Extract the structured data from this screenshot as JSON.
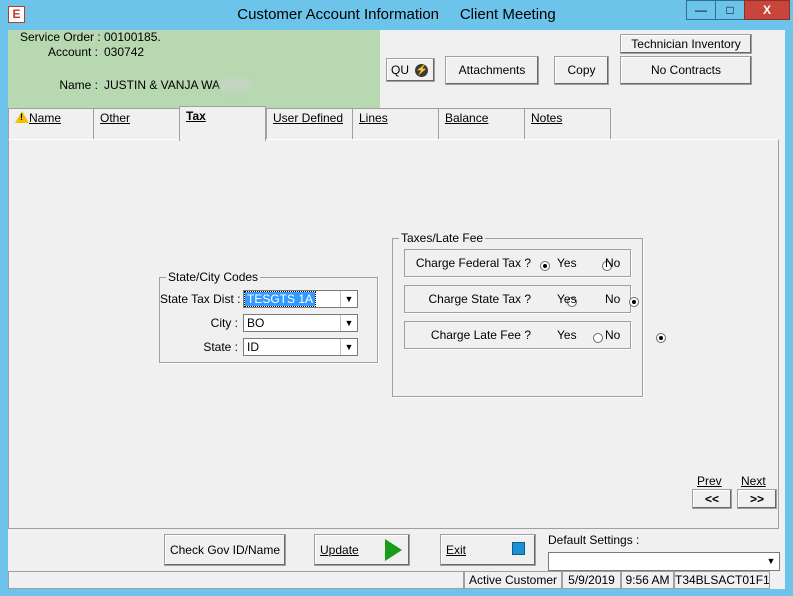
{
  "window": {
    "app_icon_letter": "E",
    "title": "Customer Account Information     Client Meeting",
    "min_label": "—",
    "max_label": "□",
    "close_label": "X"
  },
  "info": {
    "service_order_label": "Service Order :",
    "service_order_value": "00100185.",
    "account_label": "Account :",
    "account_value": "030742",
    "name_label": "Name :",
    "name_value": "JUSTIN & VANJA WA"
  },
  "toolbar": {
    "qu_label": "QU",
    "attachments_label": "Attachments",
    "copy_label": "Copy",
    "technician_inventory_label": "Technician Inventory",
    "no_contracts_label": "No Contracts"
  },
  "tabs": [
    {
      "label": "Name",
      "warning_icon": "warning-icon"
    },
    {
      "label": "Other"
    },
    {
      "label": "Tax"
    },
    {
      "label": "User Defined"
    },
    {
      "label": "Lines"
    },
    {
      "label": "Balance"
    },
    {
      "label": "Notes"
    }
  ],
  "state_city": {
    "group_title": "State/City Codes",
    "state_tax_dist_label": "State Tax Dist :",
    "state_tax_dist_value": "TESGTS 1A",
    "city_label": "City :",
    "city_value": "BO",
    "state_label": "State :",
    "state_value": "ID"
  },
  "taxes": {
    "group_title": "Taxes/Late Fee",
    "rows": [
      {
        "label": "Charge Federal Tax ?",
        "yes": "Yes",
        "no": "No",
        "selected": "yes"
      },
      {
        "label": "Charge State Tax ?",
        "yes": "Yes",
        "no": "No",
        "selected": "no"
      },
      {
        "label": "Charge Late Fee ?",
        "yes": "Yes",
        "no": "No",
        "selected": "no"
      }
    ]
  },
  "nav": {
    "prev_label": "Prev",
    "next_label": "Next",
    "prev_button": "<<",
    "next_button": ">>"
  },
  "bottom": {
    "check_gov_label": "Check Gov ID/Name",
    "update_label": "Update",
    "exit_label": "Exit",
    "default_settings_label": "Default Settings :",
    "default_settings_value": ""
  },
  "status": {
    "customer_status": "Active Customer",
    "date": "5/9/2019",
    "time": "9:56 AM",
    "code": "T34BLSACT01F1"
  },
  "colors": {
    "titlebar": "#6dc4ea",
    "info_panel": "#b7d8b1",
    "close_button": "#c7453a",
    "update_arrow": "#1a9b1a",
    "exit_square": "#1c8fd6"
  }
}
